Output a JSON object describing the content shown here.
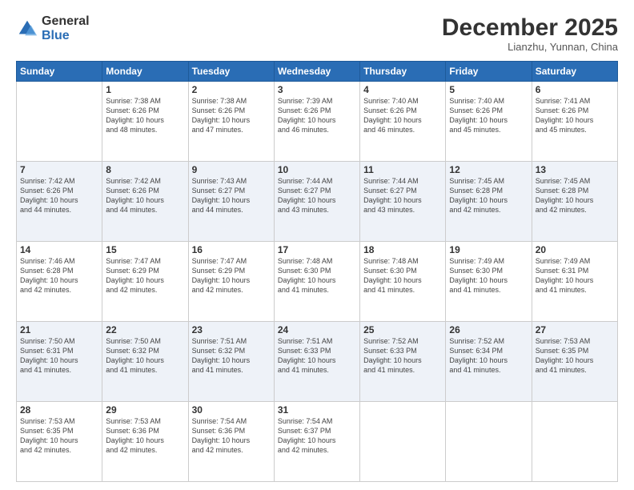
{
  "logo": {
    "general": "General",
    "blue": "Blue"
  },
  "header": {
    "month": "December 2025",
    "location": "Lianzhu, Yunnan, China"
  },
  "weekdays": [
    "Sunday",
    "Monday",
    "Tuesday",
    "Wednesday",
    "Thursday",
    "Friday",
    "Saturday"
  ],
  "weeks": [
    [
      {
        "day": "",
        "info": ""
      },
      {
        "day": "1",
        "info": "Sunrise: 7:38 AM\nSunset: 6:26 PM\nDaylight: 10 hours\nand 48 minutes."
      },
      {
        "day": "2",
        "info": "Sunrise: 7:38 AM\nSunset: 6:26 PM\nDaylight: 10 hours\nand 47 minutes."
      },
      {
        "day": "3",
        "info": "Sunrise: 7:39 AM\nSunset: 6:26 PM\nDaylight: 10 hours\nand 46 minutes."
      },
      {
        "day": "4",
        "info": "Sunrise: 7:40 AM\nSunset: 6:26 PM\nDaylight: 10 hours\nand 46 minutes."
      },
      {
        "day": "5",
        "info": "Sunrise: 7:40 AM\nSunset: 6:26 PM\nDaylight: 10 hours\nand 45 minutes."
      },
      {
        "day": "6",
        "info": "Sunrise: 7:41 AM\nSunset: 6:26 PM\nDaylight: 10 hours\nand 45 minutes."
      }
    ],
    [
      {
        "day": "7",
        "info": "Sunrise: 7:42 AM\nSunset: 6:26 PM\nDaylight: 10 hours\nand 44 minutes."
      },
      {
        "day": "8",
        "info": "Sunrise: 7:42 AM\nSunset: 6:26 PM\nDaylight: 10 hours\nand 44 minutes."
      },
      {
        "day": "9",
        "info": "Sunrise: 7:43 AM\nSunset: 6:27 PM\nDaylight: 10 hours\nand 44 minutes."
      },
      {
        "day": "10",
        "info": "Sunrise: 7:44 AM\nSunset: 6:27 PM\nDaylight: 10 hours\nand 43 minutes."
      },
      {
        "day": "11",
        "info": "Sunrise: 7:44 AM\nSunset: 6:27 PM\nDaylight: 10 hours\nand 43 minutes."
      },
      {
        "day": "12",
        "info": "Sunrise: 7:45 AM\nSunset: 6:28 PM\nDaylight: 10 hours\nand 42 minutes."
      },
      {
        "day": "13",
        "info": "Sunrise: 7:45 AM\nSunset: 6:28 PM\nDaylight: 10 hours\nand 42 minutes."
      }
    ],
    [
      {
        "day": "14",
        "info": "Sunrise: 7:46 AM\nSunset: 6:28 PM\nDaylight: 10 hours\nand 42 minutes."
      },
      {
        "day": "15",
        "info": "Sunrise: 7:47 AM\nSunset: 6:29 PM\nDaylight: 10 hours\nand 42 minutes."
      },
      {
        "day": "16",
        "info": "Sunrise: 7:47 AM\nSunset: 6:29 PM\nDaylight: 10 hours\nand 42 minutes."
      },
      {
        "day": "17",
        "info": "Sunrise: 7:48 AM\nSunset: 6:30 PM\nDaylight: 10 hours\nand 41 minutes."
      },
      {
        "day": "18",
        "info": "Sunrise: 7:48 AM\nSunset: 6:30 PM\nDaylight: 10 hours\nand 41 minutes."
      },
      {
        "day": "19",
        "info": "Sunrise: 7:49 AM\nSunset: 6:30 PM\nDaylight: 10 hours\nand 41 minutes."
      },
      {
        "day": "20",
        "info": "Sunrise: 7:49 AM\nSunset: 6:31 PM\nDaylight: 10 hours\nand 41 minutes."
      }
    ],
    [
      {
        "day": "21",
        "info": "Sunrise: 7:50 AM\nSunset: 6:31 PM\nDaylight: 10 hours\nand 41 minutes."
      },
      {
        "day": "22",
        "info": "Sunrise: 7:50 AM\nSunset: 6:32 PM\nDaylight: 10 hours\nand 41 minutes."
      },
      {
        "day": "23",
        "info": "Sunrise: 7:51 AM\nSunset: 6:32 PM\nDaylight: 10 hours\nand 41 minutes."
      },
      {
        "day": "24",
        "info": "Sunrise: 7:51 AM\nSunset: 6:33 PM\nDaylight: 10 hours\nand 41 minutes."
      },
      {
        "day": "25",
        "info": "Sunrise: 7:52 AM\nSunset: 6:33 PM\nDaylight: 10 hours\nand 41 minutes."
      },
      {
        "day": "26",
        "info": "Sunrise: 7:52 AM\nSunset: 6:34 PM\nDaylight: 10 hours\nand 41 minutes."
      },
      {
        "day": "27",
        "info": "Sunrise: 7:53 AM\nSunset: 6:35 PM\nDaylight: 10 hours\nand 41 minutes."
      }
    ],
    [
      {
        "day": "28",
        "info": "Sunrise: 7:53 AM\nSunset: 6:35 PM\nDaylight: 10 hours\nand 42 minutes."
      },
      {
        "day": "29",
        "info": "Sunrise: 7:53 AM\nSunset: 6:36 PM\nDaylight: 10 hours\nand 42 minutes."
      },
      {
        "day": "30",
        "info": "Sunrise: 7:54 AM\nSunset: 6:36 PM\nDaylight: 10 hours\nand 42 minutes."
      },
      {
        "day": "31",
        "info": "Sunrise: 7:54 AM\nSunset: 6:37 PM\nDaylight: 10 hours\nand 42 minutes."
      },
      {
        "day": "",
        "info": ""
      },
      {
        "day": "",
        "info": ""
      },
      {
        "day": "",
        "info": ""
      }
    ]
  ]
}
